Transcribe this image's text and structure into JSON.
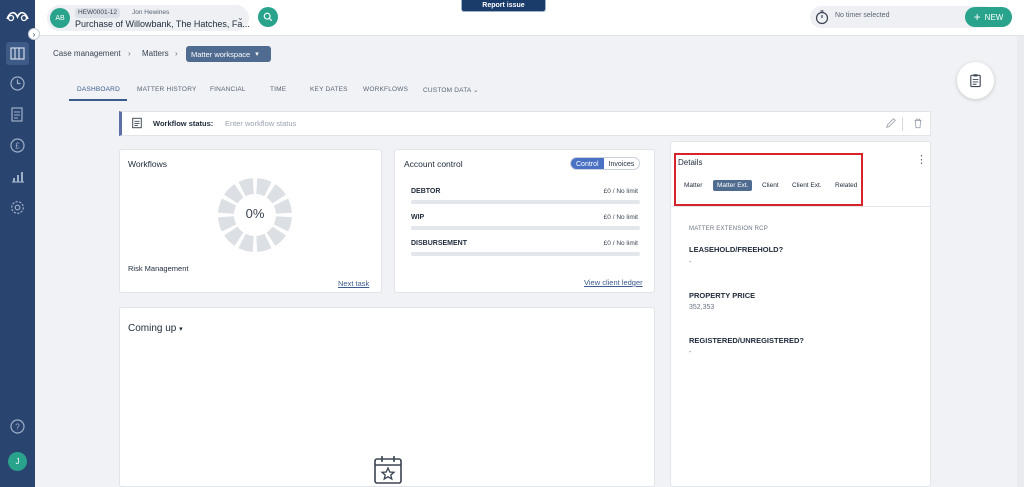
{
  "header": {
    "matter_avatar": "AB",
    "matter_code": "HEW0001-12",
    "matter_user": "Jon Hewines",
    "matter_title": "Purchase of Willowbank, The Hatches, Fa...",
    "report_issue": "Report issue",
    "timer_text": "No timer selected",
    "new_label": "NEW"
  },
  "breadcrumb": {
    "item1": "Case management",
    "item2": "Matters",
    "current": "Matter workspace"
  },
  "tabs": [
    "DASHBOARD",
    "MATTER HISTORY",
    "FINANCIAL",
    "TIME",
    "KEY DATES",
    "WORKFLOWS",
    "CUSTOM DATA"
  ],
  "workflow_status": {
    "label": "Workflow status:",
    "placeholder": "Enter workflow status"
  },
  "workflows_card": {
    "title": "Workflows",
    "percent": "0%",
    "progress": 0,
    "subtitle": "Risk Management",
    "link": "Next task"
  },
  "account_card": {
    "title": "Account control",
    "toggle_on": "Control",
    "toggle_off": "Invoices",
    "rows": [
      {
        "label": "DEBTOR",
        "value": "£0 / No limit"
      },
      {
        "label": "WIP",
        "value": "£0 / No limit"
      },
      {
        "label": "DISBURSEMENT",
        "value": "£0 / No limit"
      }
    ],
    "link": "View client ledger"
  },
  "details_card": {
    "title": "Details",
    "tabs": [
      "Matter",
      "Matter Ext.",
      "Client",
      "Client Ext.",
      "Related"
    ],
    "section": "MATTER EXTENSION RCP",
    "fields": [
      {
        "label": "LEASEHOLD/FREEHOLD?",
        "value": "-"
      },
      {
        "label": "PROPERTY PRICE",
        "value": "352,353"
      },
      {
        "label": "REGISTERED/UNREGISTERED?",
        "value": "-"
      }
    ]
  },
  "coming_up": {
    "title": "Coming up"
  },
  "sidebar": {
    "avatar": "J"
  },
  "colors": {
    "sidebar": "#2a4470",
    "accent_green": "#2aa38c",
    "highlight_red": "#d8232a"
  }
}
